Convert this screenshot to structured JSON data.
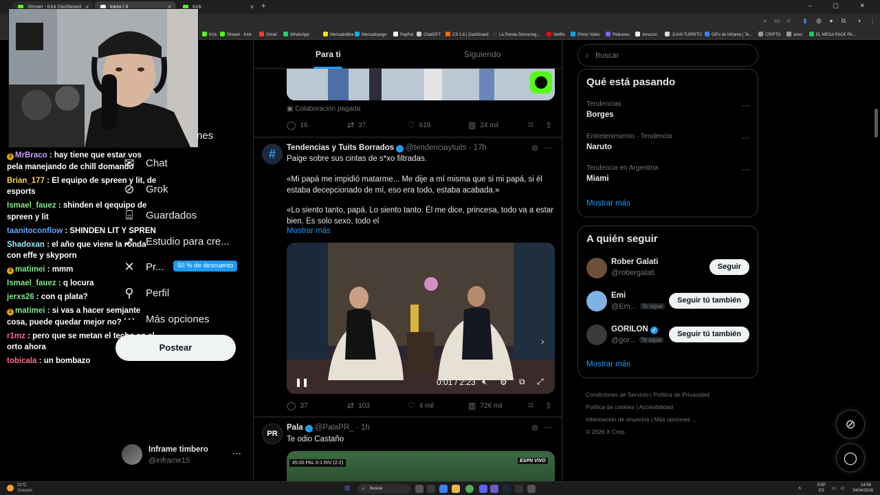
{
  "browser": {
    "tabs": [
      {
        "label": "Stream - Kick Dashboard",
        "color": "#53fc18"
      },
      {
        "label": "Inicio / X",
        "color": "#ffffff"
      },
      {
        "label": "Kick",
        "color": "#53fc18"
      }
    ],
    "new_tab": "+",
    "window_controls": "– ▢ ✕",
    "bookmarks": [
      {
        "label": "Kick",
        "color": "#53fc18"
      },
      {
        "label": "Stream - Kick",
        "color": "#53fc18"
      },
      {
        "label": "Gmail",
        "color": "#ea4335"
      },
      {
        "label": "WhatsApp",
        "color": "#25d366"
      },
      {
        "label": "Mercadolibre",
        "color": "#ffe600"
      },
      {
        "label": "Mercadopago",
        "color": "#00b1ea"
      },
      {
        "label": "PayPal",
        "color": "#ffffff"
      },
      {
        "label": "ChatGPT",
        "color": "#cccccc"
      },
      {
        "label": "CS 1.6 | Dashboard",
        "color": "#ff6a00"
      },
      {
        "label": "La Ronda Simracing...",
        "color": "#333333"
      },
      {
        "label": "Netflix",
        "color": "#e50914"
      },
      {
        "label": "Prime Video",
        "color": "#00a8e1"
      },
      {
        "label": "Releases",
        "color": "#8a5cf6"
      },
      {
        "label": "Amazon",
        "color": "#ffffff"
      },
      {
        "label": "JUAN TURRITO",
        "color": "#dddddd"
      },
      {
        "label": "GIFs de Inframe | Te...",
        "color": "#3b82f6"
      },
      {
        "label": "CRIPTO",
        "color": "#999999"
      },
      {
        "label": "aires",
        "color": "#999999"
      },
      {
        "label": "EL MEGA PACK PA...",
        "color": "#22c55e"
      }
    ]
  },
  "chat": [
    {
      "user": "MrBraco",
      "color": "#c9a0ff",
      "badge": "1",
      "text": "hay tiene que estar vos pela manejando de chill domando"
    },
    {
      "user": "Brian_177",
      "color": "#ffd23f",
      "badge": "",
      "text": "El equipo de spreen y lit, de esports"
    },
    {
      "user": "Ismael_fauez",
      "color": "#7ee787",
      "badge": "",
      "text": "shinden el qequipo de spreen y lit"
    },
    {
      "user": "taanitoconflow",
      "color": "#5fa8ff",
      "badge": "",
      "text": "SHINDEN LIT Y SPREN"
    },
    {
      "user": "Shadoxan",
      "color": "#9ee6ff",
      "badge": "",
      "text": "el año que viene la ronda con effe y skyporn"
    },
    {
      "user": "matimei",
      "color": "#7ee787",
      "badge": "1",
      "text": "mmm"
    },
    {
      "user": "Ismael_fauez",
      "color": "#7ee787",
      "badge": "",
      "text": "q locura"
    },
    {
      "user": "jerxs26",
      "color": "#7ee787",
      "badge": "",
      "text": "con q plata?"
    },
    {
      "user": "matimei",
      "color": "#7ee787",
      "badge": "1",
      "text": "si vas a hacer semjante cosa, puede quedar mejor no?"
    },
    {
      "user": "r1mz",
      "color": "#ff6b8a",
      "badge": "",
      "text": "pero que se metan el techo en el orto ahora"
    },
    {
      "user": "tobicala",
      "color": "#ff6b8a",
      "badge": "",
      "text": "un bombazo"
    }
  ],
  "nav": {
    "partial_top": "nes",
    "items": [
      {
        "label": "Chat",
        "icon": "chat-icon"
      },
      {
        "label": "Grok",
        "icon": "grok-icon"
      },
      {
        "label": "Guardados",
        "icon": "bookmark-icon"
      },
      {
        "label": "Estudio para cre...",
        "icon": "rocket-icon"
      },
      {
        "label": "Pr...",
        "icon": "x-logo-icon"
      },
      {
        "label": "Perfil",
        "icon": "profile-icon"
      },
      {
        "label": "Más opciones",
        "icon": "more-icon"
      }
    ],
    "discount": "50 % de descuento",
    "post_button": "Postear",
    "account": {
      "name": "Inframe timbero",
      "handle": "@inframe15"
    }
  },
  "feed": {
    "tabs": [
      "Para ti",
      "Siguiendo"
    ],
    "post1": {
      "paid_label": "Colaboración pagada",
      "replies": "16",
      "reposts": "37",
      "likes": "619",
      "views": "24 mil"
    },
    "post2": {
      "author": "Tendencias y Tuits Borrados",
      "handle": "@tendenciaytuits",
      "time": "· 17h",
      "lines": [
        "Paige sobre sus cintas de s*xo filtradas.",
        "«Mi papá me impidió matarme... Me dije a mí misma que si mi papá, si él estaba decepcionado de mí, eso era todo, estaba acabada.»",
        "«Lo siento tanto, papá. Lo siento tanto. Él me dice, princesa, todo va a estar bien. Es solo sexo, todo el"
      ],
      "show_more": "Mostrar más",
      "video_time": "0:01 / 2:23",
      "replies": "37",
      "reposts": "103",
      "likes": "4 mil",
      "views": "726 mil"
    },
    "post3": {
      "author": "Pala",
      "handle": "@PalaPR_",
      "time": "· 1h",
      "text": "Te odio Castaño",
      "avatar_text": "PR",
      "scoreboard": "45:00  PAL  0-1  RIV  (2-2)",
      "broadcaster": "ESPN VIVO"
    }
  },
  "right": {
    "search_placeholder": "Buscar",
    "trends_title": "Qué está pasando",
    "trends": [
      {
        "category": "Tendencias",
        "name": "Borges"
      },
      {
        "category": "Entretenimiento · Tendencia",
        "name": "Naruto"
      },
      {
        "category": "Tendencia en Argentina",
        "name": "Miami"
      }
    ],
    "show_more": "Mostrar más",
    "who_title": "A quién seguir",
    "who": [
      {
        "name": "Rober Galati",
        "handle": "@robergalati",
        "follows_you": "",
        "button": "Seguir",
        "verified": false,
        "avatar": "#6b4f3a"
      },
      {
        "name": "Emi",
        "handle": "@Em...",
        "follows_you": "Te sigue",
        "button": "Seguir tú también",
        "verified": false,
        "avatar": "#7fb2e5"
      },
      {
        "name": "GORILON",
        "handle": "@gor...",
        "follows_you": "Te sigue",
        "button": "Seguir tú también",
        "verified": true,
        "avatar": "#3a3a3a"
      }
    ],
    "footer": [
      "Condiciones de Servicio",
      "Política de Privacidad",
      "Política de cookies",
      "Accesibilidad",
      "Información de anuncios",
      "Más opciones ...",
      "© 2026 X Corp."
    ]
  },
  "taskbar": {
    "weather_temp": "21°C",
    "weather_desc": "Soleado",
    "search": "Buscar",
    "lang1": "ESP",
    "lang2": "ES",
    "time": "14:56",
    "date": "24/04/2026"
  }
}
